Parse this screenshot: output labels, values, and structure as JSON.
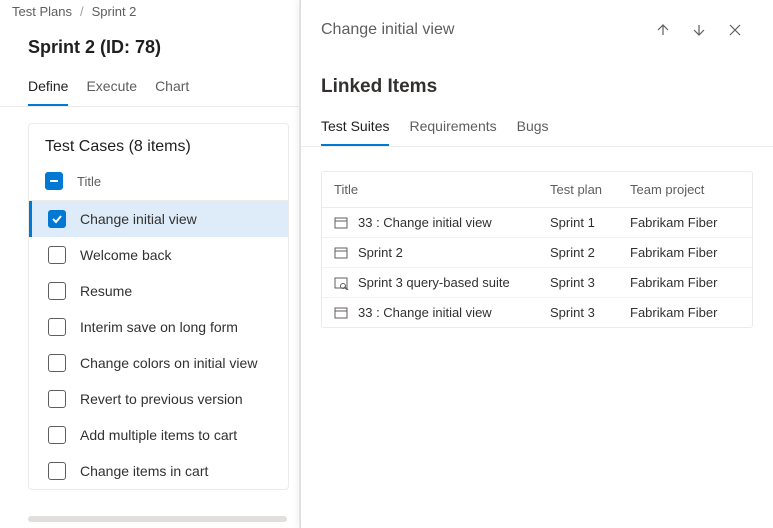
{
  "breadcrumb": {
    "root": "Test Plans",
    "current": "Sprint 2"
  },
  "page_title": "Sprint 2 (ID: 78)",
  "tabs": {
    "define": "Define",
    "execute": "Execute",
    "chart": "Chart"
  },
  "card": {
    "title": "Test Cases (8 items)",
    "header_col": "Title",
    "items": [
      {
        "title": "Change initial view",
        "checked": true
      },
      {
        "title": "Welcome back",
        "checked": false
      },
      {
        "title": "Resume",
        "checked": false
      },
      {
        "title": "Interim save on long form",
        "checked": false
      },
      {
        "title": "Change colors on initial view",
        "checked": false
      },
      {
        "title": "Revert to previous version",
        "checked": false
      },
      {
        "title": "Add multiple items to cart",
        "checked": false
      },
      {
        "title": "Change items in cart",
        "checked": false
      }
    ]
  },
  "panel": {
    "title": "Change initial view",
    "section": "Linked Items",
    "tabs": {
      "suites": "Test Suites",
      "reqs": "Requirements",
      "bugs": "Bugs"
    },
    "columns": {
      "title": "Title",
      "plan": "Test plan",
      "team": "Team project"
    },
    "rows": [
      {
        "icon": "static",
        "title": "33 : Change initial view",
        "plan": "Sprint 1",
        "team": "Fabrikam Fiber"
      },
      {
        "icon": "static",
        "title": "Sprint 2",
        "plan": "Sprint 2",
        "team": "Fabrikam Fiber"
      },
      {
        "icon": "query",
        "title": "Sprint 3 query-based suite",
        "plan": "Sprint 3",
        "team": "Fabrikam Fiber"
      },
      {
        "icon": "static",
        "title": "33 : Change initial view",
        "plan": "Sprint 3",
        "team": "Fabrikam Fiber"
      }
    ]
  }
}
